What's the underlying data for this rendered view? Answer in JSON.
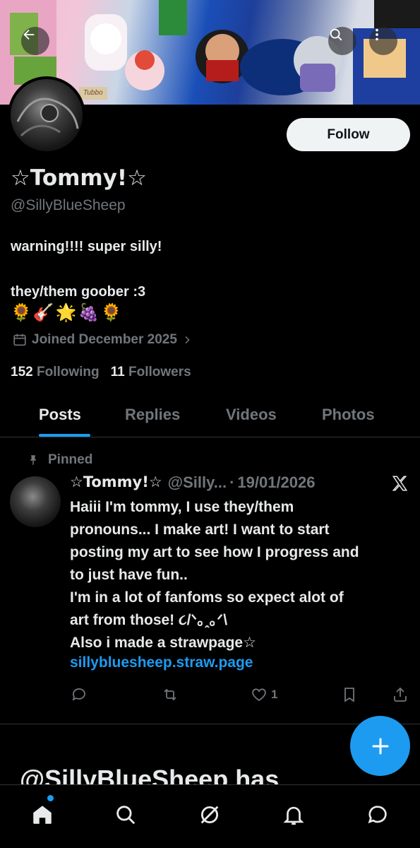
{
  "profile": {
    "display_name": "☆Tommy!☆",
    "handle": "@SillyBlueSheep",
    "bio": "warning!!!! super silly!\n\nthey/them goober :3",
    "bio_emoji": "🌻🎸🌟🍇🌻",
    "joined": "Joined December 2025",
    "following_count": "152",
    "following_label": "Following",
    "followers_count": "11",
    "followers_label": "Followers",
    "follow_label": "Follow",
    "banner_text": "Tubbo"
  },
  "tabs": [
    {
      "label": "Posts",
      "active": true
    },
    {
      "label": "Replies",
      "active": false
    },
    {
      "label": "Videos",
      "active": false
    },
    {
      "label": "Photos",
      "active": false
    }
  ],
  "pinned_post": {
    "pinned_label": "Pinned",
    "author_name": "☆Tommy!☆",
    "author_handle": "@Silly...",
    "separator": "·",
    "date": "19/01/2026",
    "text": "Haiii I'm tommy, I use they/them\npronouns... I make art! I want to start\nposting my art to see how I progress and\nto just have fun..\nI'm in a lot of fanfoms so expect alot of\nart from those! ૮/ᐠ｡ꞈ｡ᐟ\\\nAlso i made a strawpage☆",
    "link": "sillybluesheep.straw.page",
    "like_count": "1",
    "actions": [
      "reply-icon",
      "repost-icon",
      "like-icon",
      "bookmark-icon",
      "share-icon"
    ]
  },
  "cut_text": "@SillyBlueSheep has",
  "bottom_nav": [
    "home-icon",
    "search-icon",
    "grok-icon",
    "notifications-icon",
    "messages-icon"
  ],
  "colors": {
    "accent": "#1d9bf0",
    "background": "#000000",
    "text": "#e7e9ea",
    "muted": "#71767b"
  }
}
